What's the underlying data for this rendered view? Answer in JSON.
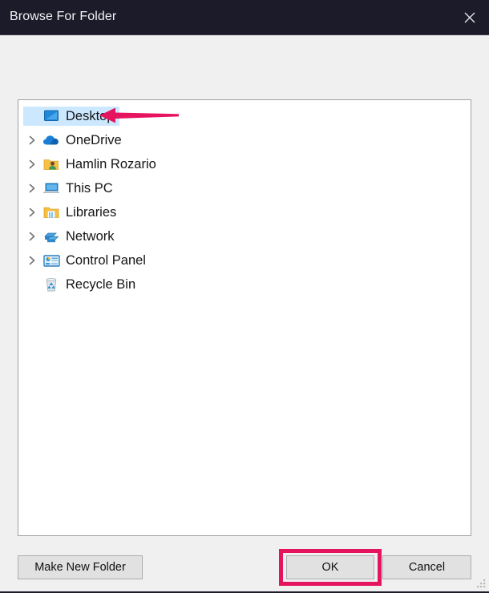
{
  "window": {
    "title": "Browse For Folder",
    "close_icon": "close-icon",
    "titlebar_color": "#1c1b2a",
    "background_color": "#f0f0f0"
  },
  "tree": {
    "items": [
      {
        "label": "Desktop",
        "icon": "desktop-monitor-icon",
        "expandable": false,
        "selected": true
      },
      {
        "label": "OneDrive",
        "icon": "cloud-icon",
        "expandable": true,
        "selected": false
      },
      {
        "label": "Hamlin Rozario",
        "icon": "user-folder-icon",
        "expandable": true,
        "selected": false
      },
      {
        "label": "This PC",
        "icon": "laptop-icon",
        "expandable": true,
        "selected": false
      },
      {
        "label": "Libraries",
        "icon": "libraries-folder-icon",
        "expandable": true,
        "selected": false
      },
      {
        "label": "Network",
        "icon": "network-icon",
        "expandable": true,
        "selected": false
      },
      {
        "label": "Control Panel",
        "icon": "control-panel-icon",
        "expandable": true,
        "selected": false
      },
      {
        "label": "Recycle Bin",
        "icon": "recycle-bin-icon",
        "expandable": false,
        "selected": false
      }
    ],
    "selection_color": "#cce8ff"
  },
  "buttons": {
    "make_new_folder": "Make New Folder",
    "ok": "OK",
    "cancel": "Cancel"
  },
  "annotations": {
    "arrow_color": "#e6145f",
    "highlight_color": "#e6145f",
    "arrow_target": "Desktop",
    "highlight_target": "OK"
  }
}
